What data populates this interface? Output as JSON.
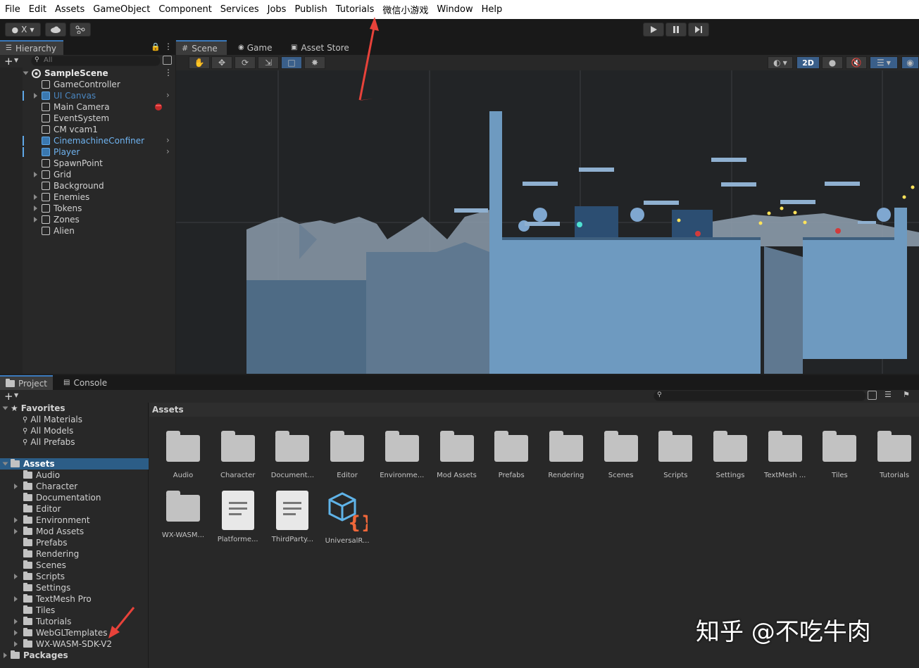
{
  "menubar": {
    "items": [
      "File",
      "Edit",
      "Assets",
      "GameObject",
      "Component",
      "Services",
      "Jobs",
      "Publish",
      "Tutorials",
      "微信小游戏",
      "Window",
      "Help"
    ]
  },
  "toolbar": {
    "account_label": "X",
    "account_icon": "user-icon",
    "cloud_icon": "cloud-icon",
    "collab_icon": "collab-icon",
    "play_icon": "play-icon",
    "pause_icon": "pause-icon",
    "step_icon": "step-icon"
  },
  "hierarchy": {
    "tab": "Hierarchy",
    "search_placeholder": "All",
    "scene": "SampleScene",
    "items": [
      {
        "label": "GameController",
        "expandable": false,
        "prefab": false
      },
      {
        "label": "UI Canvas",
        "expandable": true,
        "prefab": true,
        "dim": true
      },
      {
        "label": "Main Camera",
        "expandable": false,
        "prefab": false
      },
      {
        "label": "EventSystem",
        "expandable": false,
        "prefab": false
      },
      {
        "label": "CM vcam1",
        "expandable": false,
        "prefab": false
      },
      {
        "label": "CinemachineConfiner",
        "expandable": false,
        "prefab": true
      },
      {
        "label": "Player",
        "expandable": false,
        "prefab": true
      },
      {
        "label": "SpawnPoint",
        "expandable": false,
        "prefab": false
      },
      {
        "label": "Grid",
        "expandable": true,
        "prefab": false
      },
      {
        "label": "Background",
        "expandable": false,
        "prefab": false
      },
      {
        "label": "Enemies",
        "expandable": true,
        "prefab": false
      },
      {
        "label": "Tokens",
        "expandable": true,
        "prefab": false
      },
      {
        "label": "Zones",
        "expandable": true,
        "prefab": false
      },
      {
        "label": "Alien",
        "expandable": false,
        "prefab": false
      }
    ]
  },
  "scene_view": {
    "tabs": [
      "Scene",
      "Game",
      "Asset Store"
    ],
    "mode_2d": "2D"
  },
  "project": {
    "tabs": [
      "Project",
      "Console"
    ],
    "favorites_label": "Favorites",
    "favorites": [
      "All Materials",
      "All Models",
      "All Prefabs"
    ],
    "assets_label": "Assets",
    "tree": [
      {
        "label": "Audio",
        "expandable": false
      },
      {
        "label": "Character",
        "expandable": true
      },
      {
        "label": "Documentation",
        "expandable": false
      },
      {
        "label": "Editor",
        "expandable": false
      },
      {
        "label": "Environment",
        "expandable": true
      },
      {
        "label": "Mod Assets",
        "expandable": true
      },
      {
        "label": "Prefabs",
        "expandable": false
      },
      {
        "label": "Rendering",
        "expandable": false
      },
      {
        "label": "Scenes",
        "expandable": false
      },
      {
        "label": "Scripts",
        "expandable": true
      },
      {
        "label": "Settings",
        "expandable": false
      },
      {
        "label": "TextMesh Pro",
        "expandable": true
      },
      {
        "label": "Tiles",
        "expandable": false
      },
      {
        "label": "Tutorials",
        "expandable": true
      },
      {
        "label": "WebGLTemplates",
        "expandable": true
      },
      {
        "label": "WX-WASM-SDK-V2",
        "expandable": true
      }
    ],
    "packages_label": "Packages",
    "breadcrumb": "Assets",
    "grid": [
      {
        "label": "Audio",
        "kind": "folder"
      },
      {
        "label": "Character",
        "kind": "folder"
      },
      {
        "label": "Document...",
        "kind": "folder"
      },
      {
        "label": "Editor",
        "kind": "folder"
      },
      {
        "label": "Environme...",
        "kind": "folder"
      },
      {
        "label": "Mod Assets",
        "kind": "folder"
      },
      {
        "label": "Prefabs",
        "kind": "folder"
      },
      {
        "label": "Rendering",
        "kind": "folder"
      },
      {
        "label": "Scenes",
        "kind": "folder"
      },
      {
        "label": "Scripts",
        "kind": "folder"
      },
      {
        "label": "Settings",
        "kind": "folder"
      },
      {
        "label": "TextMesh ...",
        "kind": "folder"
      },
      {
        "label": "Tiles",
        "kind": "folder"
      },
      {
        "label": "Tutorials",
        "kind": "folder"
      },
      {
        "label": "WX-WASM...",
        "kind": "folder"
      },
      {
        "label": "Platforme...",
        "kind": "doc"
      },
      {
        "label": "ThirdParty...",
        "kind": "doc"
      },
      {
        "label": "UniversalR...",
        "kind": "package"
      }
    ]
  },
  "watermark": "知乎 @不吃牛肉",
  "colors": {
    "accent": "#3a79bb",
    "prefab_blue": "#5fa8e8",
    "annotation_red": "#e8423a"
  }
}
